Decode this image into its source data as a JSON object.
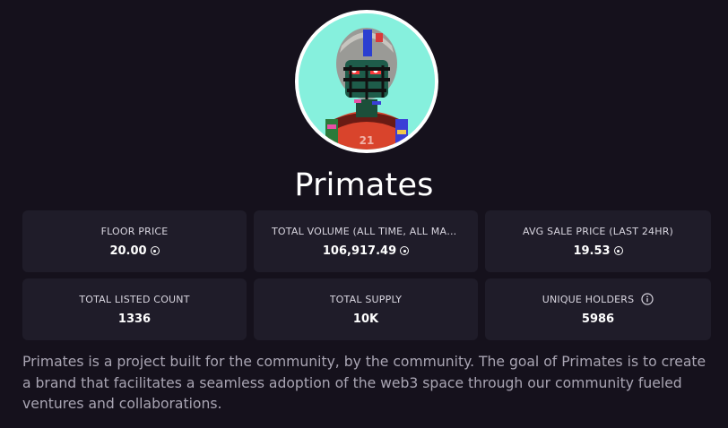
{
  "collection": {
    "name": "Primates",
    "description": "Primates is a project built for the community, by the community. The goal of Primates is to create a brand that facilitates a seamless adoption of the web3 space through our community fueled ventures and collaborations."
  },
  "stats": [
    {
      "label": "FLOOR PRICE",
      "value": "20.00",
      "icon": "solana-coin-icon"
    },
    {
      "label": "TOTAL VOLUME (ALL TIME, ALL MARK...",
      "value": "106,917.49",
      "icon": "solana-coin-icon"
    },
    {
      "label": "AVG SALE PRICE (LAST 24HR)",
      "value": "19.53",
      "icon": "solana-coin-icon"
    },
    {
      "label": "TOTAL LISTED COUNT",
      "value": "1336"
    },
    {
      "label": "TOTAL SUPPLY",
      "value": "10K"
    },
    {
      "label": "UNIQUE HOLDERS",
      "value": "5986",
      "icon": "info-icon"
    }
  ],
  "colors": {
    "background": "#15111c",
    "card": "#1f1c29",
    "description_text": "#a9a5b3",
    "avatar_bg": "#86f0dd"
  }
}
